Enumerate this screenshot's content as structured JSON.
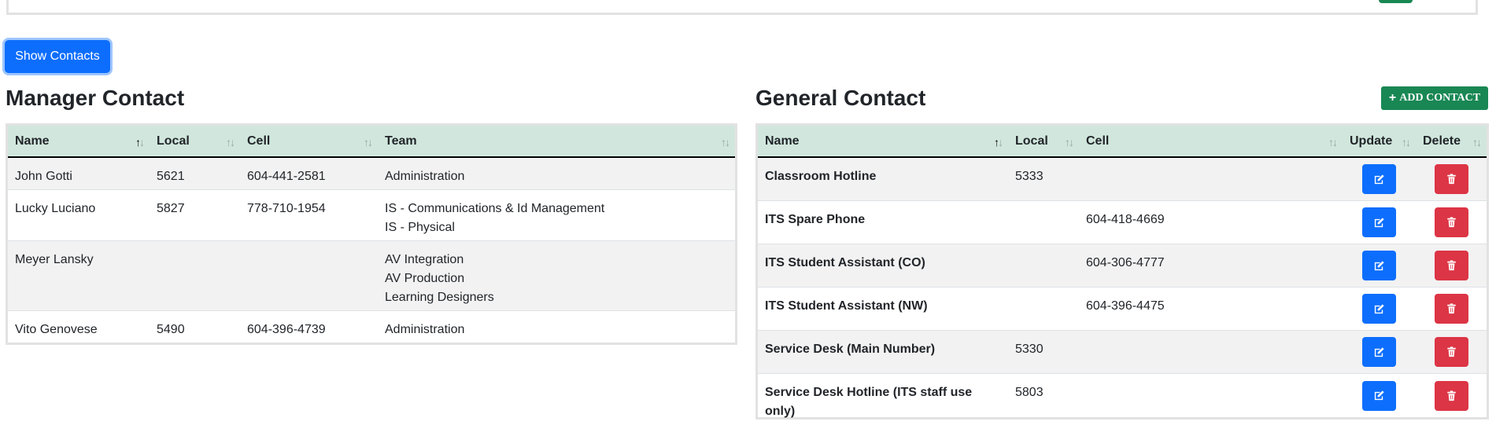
{
  "show_contacts_label": "Show Contacts",
  "manager": {
    "title": "Manager Contact",
    "columns": [
      "Name",
      "Local",
      "Cell",
      "Team"
    ],
    "rows": [
      {
        "name": "John Gotti",
        "local": "5621",
        "cell": "604-441-2581",
        "teams": [
          "Administration"
        ]
      },
      {
        "name": "Lucky Luciano",
        "local": "5827",
        "cell": "778-710-1954",
        "teams": [
          "IS - Communications & Id Management",
          "IS - Physical"
        ]
      },
      {
        "name": "Meyer Lansky",
        "local": "",
        "cell": "",
        "teams": [
          "AV Integration",
          "AV Production",
          "Learning Designers"
        ]
      },
      {
        "name": "Vito Genovese",
        "local": "5490",
        "cell": "604-396-4739",
        "teams": [
          "Administration"
        ]
      }
    ]
  },
  "general": {
    "title": "General Contact",
    "add_label": "ADD CONTACT",
    "columns": [
      "Name",
      "Local",
      "Cell",
      "Update",
      "Delete"
    ],
    "rows": [
      {
        "name": "Classroom Hotline",
        "local": "5333",
        "cell": ""
      },
      {
        "name": "ITS Spare Phone",
        "local": "",
        "cell": "604-418-4669"
      },
      {
        "name": "ITS Student Assistant (CO)",
        "local": "",
        "cell": "604-306-4777"
      },
      {
        "name": "ITS Student Assistant (NW)",
        "local": "",
        "cell": "604-396-4475"
      },
      {
        "name": "Service Desk (Main Number)",
        "local": "5330",
        "cell": ""
      },
      {
        "name": "Service Desk Hotline (ITS staff use only)",
        "local": "5803",
        "cell": ""
      }
    ]
  },
  "icons": {
    "sort": "sort-arrows-icon",
    "edit": "edit-icon",
    "delete": "trash-icon",
    "add": "plus-icon"
  },
  "colors": {
    "primary": "#0d6efd",
    "success": "#198754",
    "danger": "#dc3545",
    "header_bg": "#d1e7dd"
  }
}
